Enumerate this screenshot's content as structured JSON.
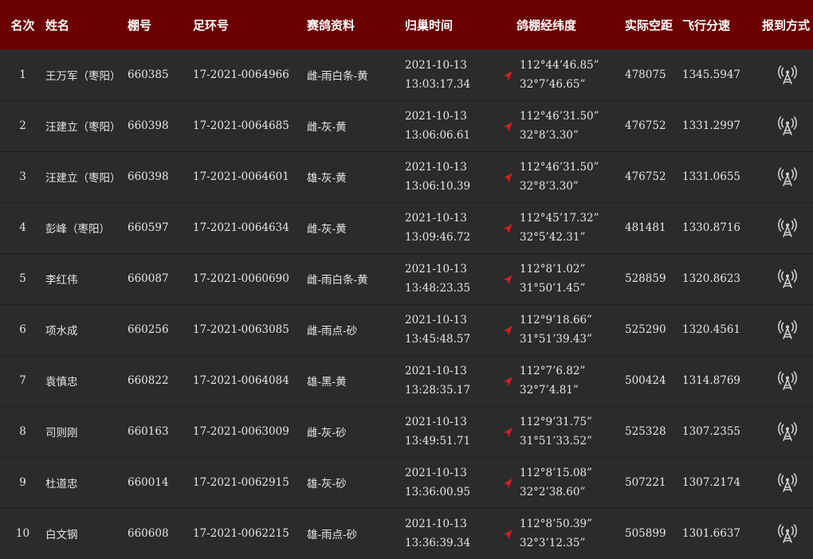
{
  "headers": {
    "rank": "名次",
    "name": "姓名",
    "loft": "棚号",
    "ring": "足环号",
    "pigeon": "赛鸽资料",
    "time": "归巢时间",
    "coords": "鸽棚经纬度",
    "distance": "实际空距",
    "speed": "飞行分速",
    "report": "报到方式"
  },
  "colors": {
    "header_bg": "#6b0000",
    "row_bg": "#2b2b2b",
    "arrow": "#d42020"
  },
  "icons": {
    "direction": "red-arrow-icon",
    "report": "signal-tower-icon"
  },
  "rows": [
    {
      "rank": "1",
      "name": "王万军（枣阳）",
      "loft": "660385",
      "ring": "17-2021-0064966",
      "pigeon": "雌-雨白条-黄",
      "date": "2021-10-13",
      "time": "13:03:17.34",
      "lon": "112°44’46.85”",
      "lat": "32°7’46.65”",
      "distance": "478075",
      "speed": "1345.5947"
    },
    {
      "rank": "2",
      "name": "汪建立（枣阳）",
      "loft": "660398",
      "ring": "17-2021-0064685",
      "pigeon": "雌-灰-黄",
      "date": "2021-10-13",
      "time": "13:06:06.61",
      "lon": "112°46’31.50”",
      "lat": "32°8’3.30”",
      "distance": "476752",
      "speed": "1331.2997"
    },
    {
      "rank": "3",
      "name": "汪建立（枣阳）",
      "loft": "660398",
      "ring": "17-2021-0064601",
      "pigeon": "雄-灰-黄",
      "date": "2021-10-13",
      "time": "13:06:10.39",
      "lon": "112°46’31.50”",
      "lat": "32°8’3.30”",
      "distance": "476752",
      "speed": "1331.0655"
    },
    {
      "rank": "4",
      "name": "彭峰（枣阳）",
      "loft": "660597",
      "ring": "17-2021-0064634",
      "pigeon": "雌-灰-黄",
      "date": "2021-10-13",
      "time": "13:09:46.72",
      "lon": "112°45’17.32”",
      "lat": "32°5’42.31”",
      "distance": "481481",
      "speed": "1330.8716"
    },
    {
      "rank": "5",
      "name": "李红伟",
      "loft": "660087",
      "ring": "17-2021-0060690",
      "pigeon": "雌-雨白条-黄",
      "date": "2021-10-13",
      "time": "13:48:23.35",
      "lon": "112°8’1.02”",
      "lat": "31°50’1.45”",
      "distance": "528859",
      "speed": "1320.8623"
    },
    {
      "rank": "6",
      "name": "项水成",
      "loft": "660256",
      "ring": "17-2021-0063085",
      "pigeon": "雌-雨点-砂",
      "date": "2021-10-13",
      "time": "13:45:48.57",
      "lon": "112°9’18.66”",
      "lat": "31°51’39.43”",
      "distance": "525290",
      "speed": "1320.4561"
    },
    {
      "rank": "7",
      "name": "袁慎忠",
      "loft": "660822",
      "ring": "17-2021-0064084",
      "pigeon": "雄-黑-黄",
      "date": "2021-10-13",
      "time": "13:28:35.17",
      "lon": "112°7’6.82”",
      "lat": "32°7’4.81”",
      "distance": "500424",
      "speed": "1314.8769"
    },
    {
      "rank": "8",
      "name": "司则刚",
      "loft": "660163",
      "ring": "17-2021-0063009",
      "pigeon": "雌-灰-砂",
      "date": "2021-10-13",
      "time": "13:49:51.71",
      "lon": "112°9’31.75”",
      "lat": "31°51’33.52”",
      "distance": "525328",
      "speed": "1307.2355"
    },
    {
      "rank": "9",
      "name": "杜道忠",
      "loft": "660014",
      "ring": "17-2021-0062915",
      "pigeon": "雄-灰-砂",
      "date": "2021-10-13",
      "time": "13:36:00.95",
      "lon": "112°8’15.08”",
      "lat": "32°2’38.60”",
      "distance": "507221",
      "speed": "1307.2174"
    },
    {
      "rank": "10",
      "name": "白文钢",
      "loft": "660608",
      "ring": "17-2021-0062215",
      "pigeon": "雄-雨点-砂",
      "date": "2021-10-13",
      "time": "13:36:39.34",
      "lon": "112°8’50.39”",
      "lat": "32°3’12.35”",
      "distance": "505899",
      "speed": "1301.6637"
    }
  ]
}
